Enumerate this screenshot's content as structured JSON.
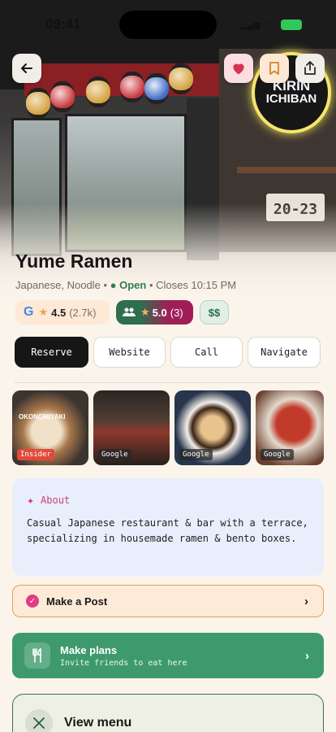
{
  "status": {
    "time": "09:41"
  },
  "hero": {
    "sign_line1": "KIRIN",
    "sign_line2": "ICHIBAN",
    "plate_text": "20-23"
  },
  "place": {
    "name": "Yume Ramen",
    "cuisine": "Japanese, Noodle",
    "open_status": "Open",
    "closes": "Closes 10:15 PM"
  },
  "ratings": {
    "google": {
      "rating": "4.5",
      "count": "(2.7k)"
    },
    "community": {
      "rating": "5.0",
      "count": "(3)"
    },
    "price": "$$"
  },
  "actions": {
    "reserve": "Reserve",
    "website": "Website",
    "call": "Call",
    "navigate": "Navigate"
  },
  "photos": [
    {
      "tag": "Insider",
      "caption": "OKONOMIYAKI"
    },
    {
      "tag": "Google"
    },
    {
      "tag": "Google"
    },
    {
      "tag": "Google"
    }
  ],
  "about": {
    "heading": "About",
    "text": "Casual Japanese restaurant & bar with a terrace, specializing in housemade ramen & bento boxes."
  },
  "post": {
    "label": "Make a Post"
  },
  "plans": {
    "title": "Make plans",
    "subtitle": "Invite friends to eat here"
  },
  "menu": {
    "label": "View menu"
  },
  "colors": {
    "background": "#fbf4ea",
    "open_green": "#2e7d4f",
    "plans_green": "#3e9a6d",
    "about_pink": "#cf3f7a",
    "reserve_black": "#161616"
  }
}
